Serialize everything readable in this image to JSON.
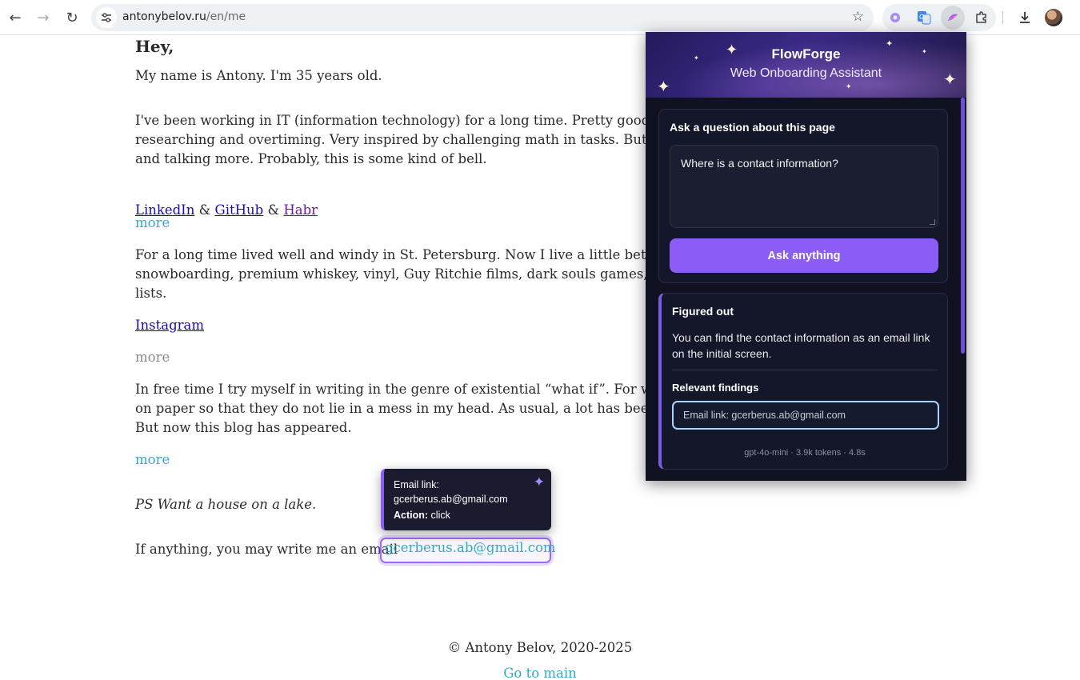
{
  "browser": {
    "url_domain": "antonybelov.ru",
    "url_path": "/en/me"
  },
  "page": {
    "greeting": "Hey,",
    "intro": "My name is Antony. I'm 35 years old.",
    "para_it": "I've been working in IT (information technology) for a long time. Pretty good at s\nresearching and overtiming. Very inspired by challenging math in tasks. But actua\nand talking more. Probably, this is some kind of bell.",
    "links_row": {
      "linkedin": "LinkedIn",
      "sep1": " & ",
      "github": "GitHub",
      "sep2": " & ",
      "habr": "Habr"
    },
    "more_1": "more",
    "para_life": "For a long time lived well and windy in St. Petersburg. Now I live a little better but\nsnowboarding, premium whiskey, vinyl, Guy Ritchie films, dark souls games, joke\nlists.",
    "instagram": "Instagram",
    "more_2": "more",
    "para_writing": "In free time I try myself in writing in the genre of existential “what if”. For what?\non paper so that they do not lie in a mess in my head. As usual, a lot has been start\nBut now this blog has appeared.",
    "more_3": "more",
    "ps": "PS Want a house on a lake.",
    "email_prefix": "If anything, you may write me an email",
    "email": "gcerberus.ab@gmail.com",
    "copyright": "© Antony Belov, 2020-2025",
    "go_main": "Go to main"
  },
  "tooltip": {
    "line1": "Email link:",
    "line2": "gcerberus.ab@gmail.com",
    "action_label": "Action:",
    "action_value": " click"
  },
  "assistant": {
    "title": "FlowForge",
    "subtitle": "Web Onboarding Assistant",
    "question_label": "Ask a question about this page",
    "question_value": "Where is a contact information?",
    "ask_button": "Ask anything",
    "result_title": "Figured out",
    "answer": "You can find the contact information as an email link on the initial screen.",
    "findings_title": "Relevant findings",
    "finding_1": "Email link: gcerberus.ab@gmail.com",
    "meta": "gpt-4o-mini · 3.9k tokens · 4.8s"
  },
  "colors": {
    "accent": "#8b5cf6",
    "link_teal": "#30a9c9",
    "panel_bg": "#101222"
  }
}
